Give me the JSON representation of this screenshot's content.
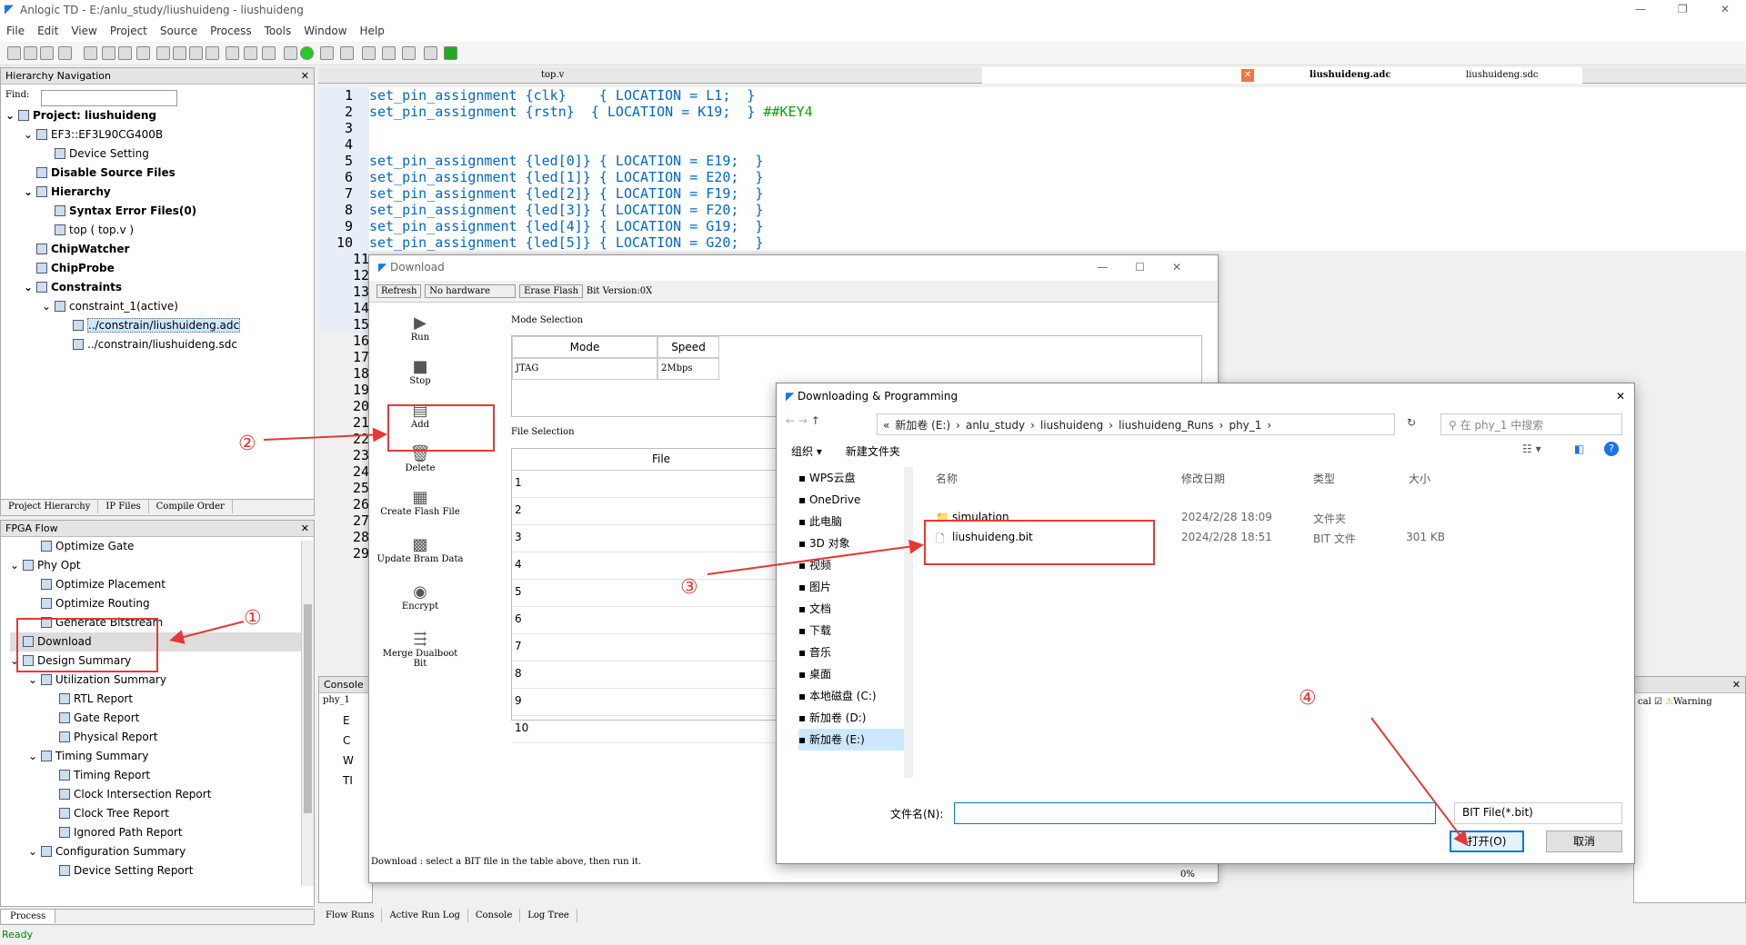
{
  "app": {
    "title": "Anlogic TD - E:/anlu_study/liushuideng - liushuideng",
    "window_controls": [
      "—",
      "❐",
      "✕"
    ]
  },
  "menu": [
    "File",
    "Edit",
    "View",
    "Project",
    "Source",
    "Process",
    "Tools",
    "Window",
    "Help"
  ],
  "hier": {
    "title": "Hierarchy Navigation",
    "find_label": "Find:",
    "items": [
      {
        "t": "Project: liushuideng",
        "b": true,
        "indent": 0,
        "exp": "⌄"
      },
      {
        "t": "EF3::EF3L90CG400B",
        "b": false,
        "indent": 1,
        "exp": "⌄"
      },
      {
        "t": "Device Setting",
        "b": false,
        "indent": 2,
        "exp": ""
      },
      {
        "t": "Disable Source Files",
        "b": true,
        "indent": 1,
        "exp": ""
      },
      {
        "t": "Hierarchy",
        "b": true,
        "indent": 1,
        "exp": "⌄"
      },
      {
        "t": "Syntax Error Files(0)",
        "b": true,
        "indent": 2,
        "exp": ""
      },
      {
        "t": "top ( top.v )",
        "b": false,
        "indent": 2,
        "exp": ""
      },
      {
        "t": "ChipWatcher",
        "b": true,
        "indent": 1,
        "exp": ""
      },
      {
        "t": "ChipProbe",
        "b": true,
        "indent": 1,
        "exp": ""
      },
      {
        "t": "Constraints",
        "b": true,
        "indent": 1,
        "exp": "⌄"
      },
      {
        "t": "constraint_1(active)",
        "b": false,
        "indent": 2,
        "exp": "⌄"
      },
      {
        "t": "../constrain/liushuideng.adc",
        "b": false,
        "indent": 3,
        "exp": "",
        "sel": true
      },
      {
        "t": "../constrain/liushuideng.sdc",
        "b": false,
        "indent": 3,
        "exp": ""
      }
    ],
    "tabs": [
      "Project Hierarchy",
      "IP Files",
      "Compile Order"
    ]
  },
  "flow": {
    "title": "FPGA Flow",
    "items": [
      {
        "t": "Optimize Gate",
        "indent": 1,
        "exp": ""
      },
      {
        "t": "Phy Opt",
        "indent": 0,
        "exp": "⌄"
      },
      {
        "t": "Optimize Placement",
        "indent": 1,
        "exp": ""
      },
      {
        "t": "Optimize Routing",
        "indent": 1,
        "exp": ""
      },
      {
        "t": "Generate Bitstream",
        "indent": 1,
        "exp": ""
      },
      {
        "t": "Download",
        "indent": 0,
        "exp": "",
        "sel": true
      },
      {
        "t": "Design Summary",
        "indent": 0,
        "exp": "⌄"
      },
      {
        "t": "Utilization Summary",
        "indent": 1,
        "exp": "⌄"
      },
      {
        "t": "RTL Report",
        "indent": 2,
        "exp": ""
      },
      {
        "t": "Gate Report",
        "indent": 2,
        "exp": ""
      },
      {
        "t": "Physical Report",
        "indent": 2,
        "exp": ""
      },
      {
        "t": "Timing Summary",
        "indent": 1,
        "exp": "⌄"
      },
      {
        "t": "Timing Report",
        "indent": 2,
        "exp": ""
      },
      {
        "t": "Clock Intersection Report",
        "indent": 2,
        "exp": ""
      },
      {
        "t": "Clock Tree Report",
        "indent": 2,
        "exp": ""
      },
      {
        "t": "Ignored Path Report",
        "indent": 2,
        "exp": ""
      },
      {
        "t": "Configuration Summary",
        "indent": 1,
        "exp": "⌄"
      },
      {
        "t": "Device Setting Report",
        "indent": 2,
        "exp": ""
      }
    ],
    "tab": "Process",
    "status": "Ready"
  },
  "editor": {
    "tabs": [
      "top.v",
      "liushuideng.adc",
      "liushuideng.sdc"
    ],
    "lines": [
      {
        "n": "1",
        "pre": "set_pin_assignment {clk}    { LOCATION = L1;  }",
        "cm": ""
      },
      {
        "n": "2",
        "pre": "set_pin_assignment {rstn}  { LOCATION = K19;  } ",
        "cm": "##KEY4"
      },
      {
        "n": "3",
        "pre": "",
        "cm": ""
      },
      {
        "n": "4",
        "pre": "",
        "cm": ""
      },
      {
        "n": "5",
        "pre": "set_pin_assignment {led[0]} { LOCATION = E19;  }",
        "cm": ""
      },
      {
        "n": "6",
        "pre": "set_pin_assignment {led[1]} { LOCATION = E20;  }",
        "cm": ""
      },
      {
        "n": "7",
        "pre": "set_pin_assignment {led[2]} { LOCATION = F19;  }",
        "cm": ""
      },
      {
        "n": "8",
        "pre": "set_pin_assignment {led[3]} { LOCATION = F20;  }",
        "cm": ""
      },
      {
        "n": "9",
        "pre": "set_pin_assignment {led[4]} { LOCATION = G19;  }",
        "cm": ""
      },
      {
        "n": "10",
        "pre": "set_pin_assignment {led[5]} { LOCATION = G20;  }",
        "cm": ""
      }
    ],
    "extra_nums": [
      "11",
      "12",
      "13",
      "14",
      "15",
      "16",
      "17",
      "18",
      "19",
      "20",
      "21",
      "22",
      "23",
      "24",
      "25",
      "26",
      "27",
      "28",
      "29"
    ]
  },
  "console": {
    "title": "Console",
    "tab": "phy_1",
    "rows": [
      "E",
      "C",
      "W",
      "TI"
    ],
    "bottom_tabs": [
      "Flow Runs",
      "Active Run Log",
      "Console",
      "Log Tree"
    ],
    "right_labels": [
      "cal",
      "Warning"
    ]
  },
  "download": {
    "title": "Download",
    "refresh": "Refresh",
    "hardware": "No hardware",
    "erase": "Erase Flash",
    "bitver": "Bit Version:0X",
    "side": [
      "Run",
      "Stop",
      "Add",
      "Delete",
      "Create Flash File",
      "Update Bram Data",
      "Encrypt",
      "Merge Dualboot Bit"
    ],
    "mode_sel": "Mode Selection",
    "mode_h": "Mode",
    "speed_h": "Speed",
    "mode_v": "JTAG",
    "speed_v": "2Mbps",
    "file_sel": "File Selection",
    "file_h": "File",
    "rows": [
      "1",
      "2",
      "3",
      "4",
      "5",
      "6",
      "7",
      "8",
      "9",
      "10"
    ],
    "status": "Download : select a BIT file in the table above, then run it.",
    "pct": "0%"
  },
  "open": {
    "title": "Downloading & Programming",
    "path": [
      "«",
      "新加卷 (E:)",
      "›",
      "anlu_study",
      "›",
      "liushuideng",
      "›",
      "liushuideng_Runs",
      "›",
      "phy_1",
      "›"
    ],
    "search": "在 phy_1 中搜索",
    "organize": "组织 ▾",
    "newfolder": "新建文件夹",
    "nav": [
      "WPS云盘",
      "OneDrive",
      "此电脑",
      "3D 对象",
      "视频",
      "图片",
      "文档",
      "下载",
      "音乐",
      "桌面",
      "本地磁盘 (C:)",
      "新加卷 (D:)",
      "新加卷 (E:)"
    ],
    "cols": [
      "名称",
      "修改日期",
      "类型",
      "大小"
    ],
    "files": [
      {
        "name": "simulation",
        "date": "2024/2/28 18:09",
        "type": "文件夹",
        "size": ""
      },
      {
        "name": "liushuideng.bit",
        "date": "2024/2/28 18:51",
        "type": "BIT 文件",
        "size": "301 KB"
      }
    ],
    "fname_label": "文件名(N):",
    "filter": "BIT File(*.bit)",
    "ok": "打开(O)",
    "cancel": "取消"
  },
  "annotations": [
    "①",
    "②",
    "③",
    "④"
  ],
  "colors": {
    "accent": "#0078d7",
    "annotation": "#e53935"
  }
}
